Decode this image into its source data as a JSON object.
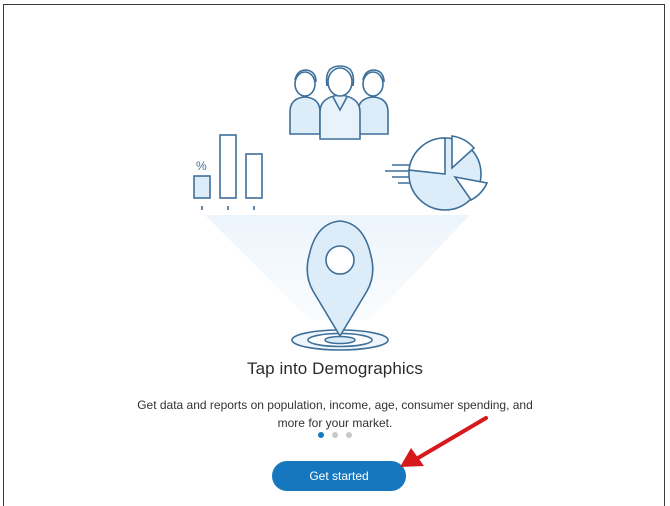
{
  "onboarding": {
    "title": "Tap into Demographics",
    "description": "Get data and reports on population, income, age, consumer spending, and more for your market.",
    "percent_symbol": "%",
    "pagination": {
      "total": 3,
      "active": 1
    },
    "cta_label": "Get started"
  },
  "colors": {
    "accent": "#1677bf",
    "illustration_stroke": "#3d6f9a",
    "illustration_fill": "#dcecf8",
    "dot_inactive": "#c9c9c9",
    "annotation_arrow": "#d8191c"
  },
  "icons": [
    "people-group-icon",
    "bar-chart-icon",
    "pie-chart-icon",
    "location-pin-icon"
  ]
}
